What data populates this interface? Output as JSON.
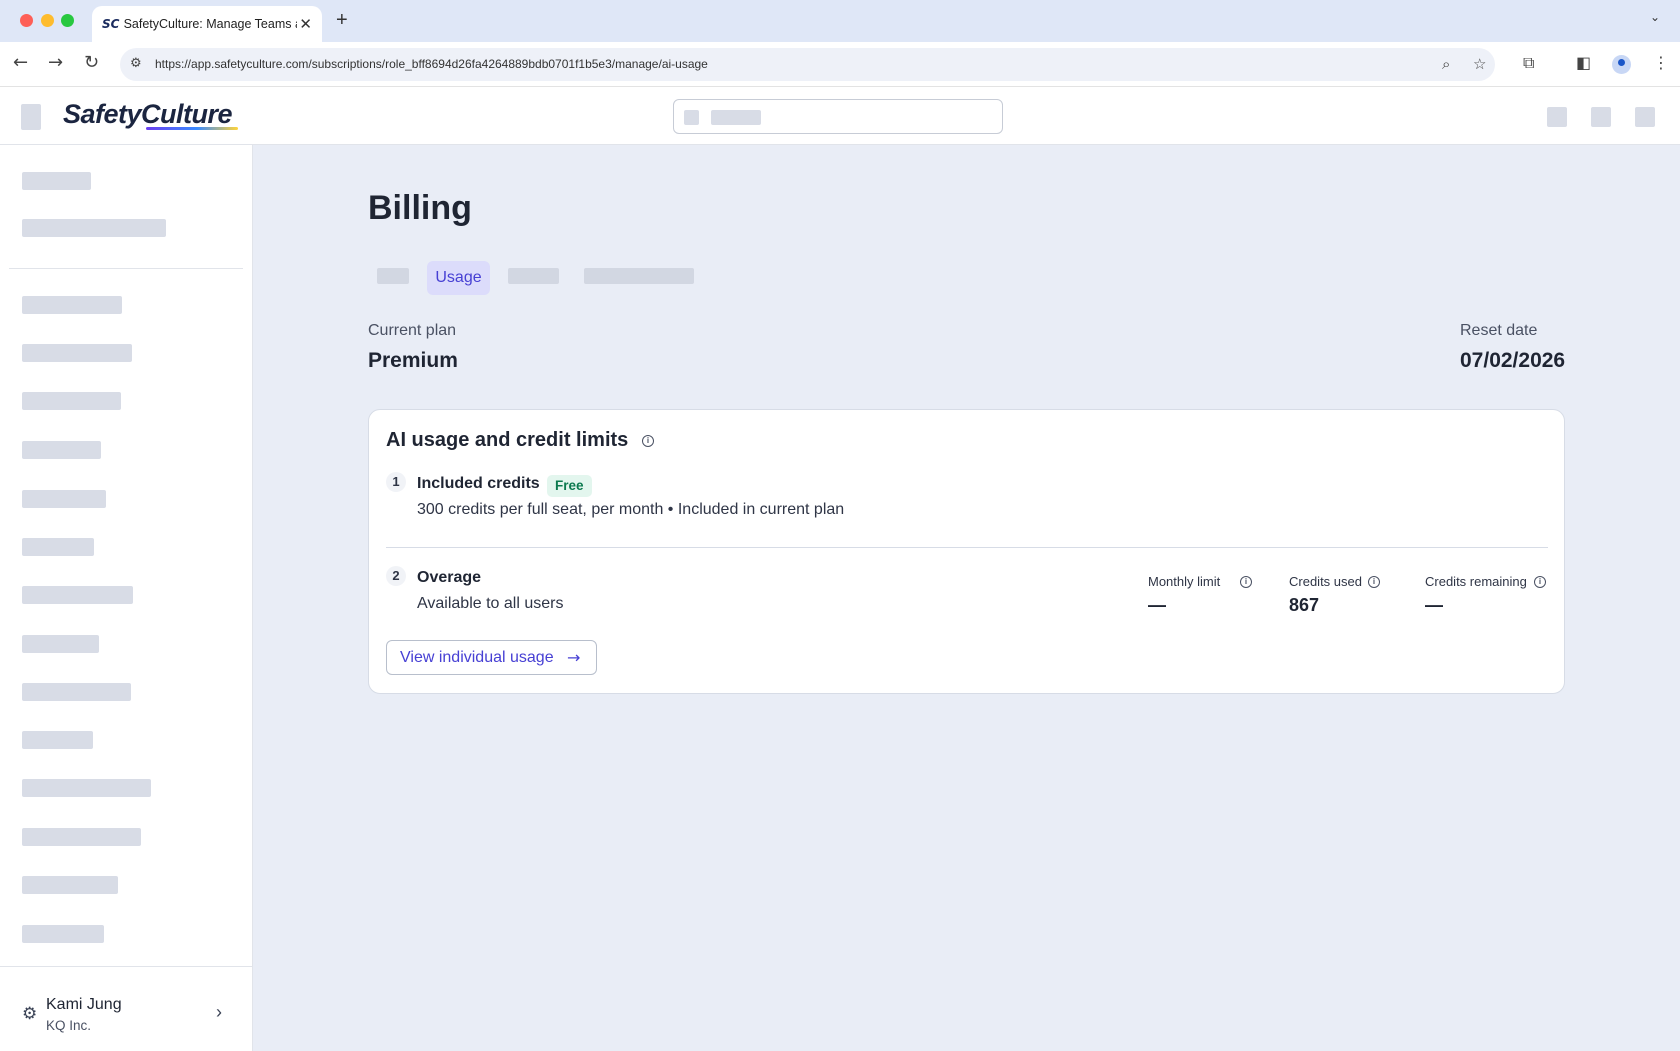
{
  "browser": {
    "tab_title": "SafetyCulture: Manage Teams and...",
    "tab_favicon": "SC",
    "url": "https://app.safetyculture.com/subscriptions/role_bff8694d26fa4264889bdb0701f1b5e3/manage/ai-usage"
  },
  "header": {
    "logo": "SafetyCulture"
  },
  "sidebar": {
    "user_name": "Kami Jung",
    "user_org": "KQ Inc."
  },
  "main": {
    "title": "Billing",
    "active_tab": "Usage",
    "current_plan_label": "Current plan",
    "current_plan_value": "Premium",
    "reset_date_label": "Reset date",
    "reset_date_value": "07/02/2026"
  },
  "card": {
    "title": "AI usage and credit limits",
    "included": {
      "number": "1",
      "title": "Included credits",
      "badge": "Free",
      "description": "300 credits per full seat, per month • Included in current plan"
    },
    "overage": {
      "number": "2",
      "title": "Overage",
      "description": "Available to all users",
      "metrics": [
        {
          "label": "Monthly limit",
          "value": "—"
        },
        {
          "label": "Credits used",
          "value": "867"
        },
        {
          "label": "Credits remaining",
          "value": "—"
        }
      ]
    },
    "view_button": "View individual usage"
  },
  "colors": {
    "accent": "#4740d4",
    "main_bg": "#e9edf6",
    "badge_bg": "#e3f6ee",
    "badge_text": "#0c7a4f"
  }
}
